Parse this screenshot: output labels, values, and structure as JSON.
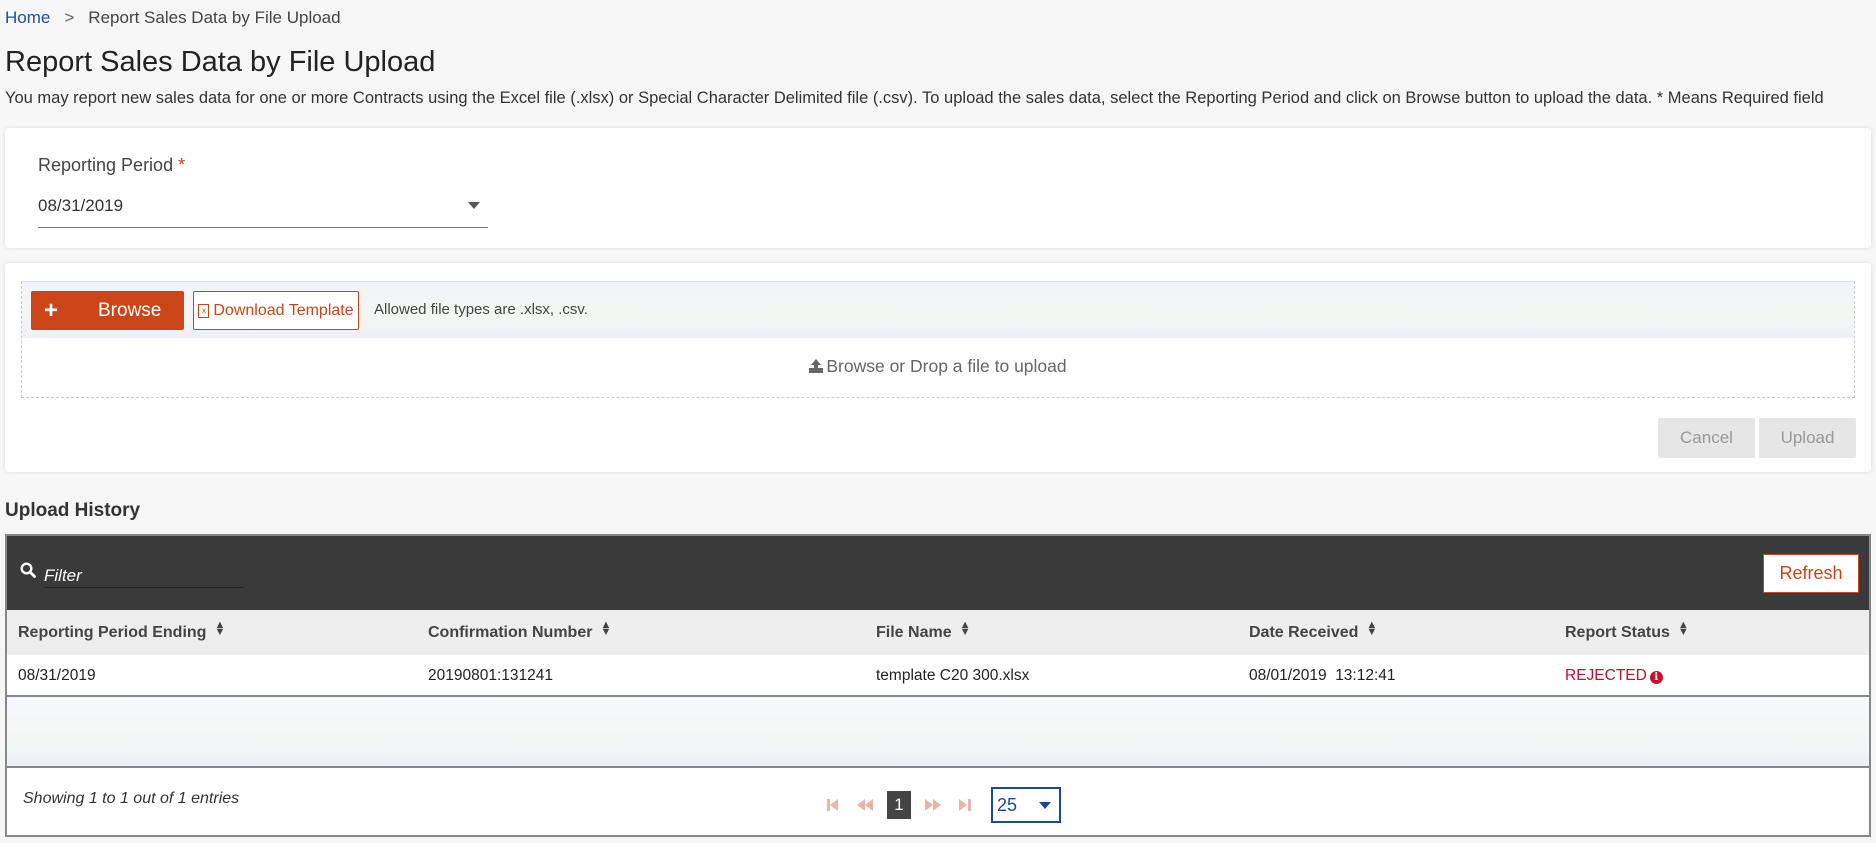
{
  "breadcrumb": {
    "home": "Home",
    "separator": ">",
    "current": "Report Sales Data by File Upload"
  },
  "page": {
    "title": "Report Sales Data by File Upload",
    "description": "You may report new sales data for one or more Contracts using the Excel file (.xlsx) or Special Character Delimited file (.csv). To upload the sales data, select the Reporting Period and click on Browse button to upload the data. * Means Required field"
  },
  "reporting_period": {
    "label": "Reporting Period",
    "required_mark": "*",
    "value": "08/31/2019"
  },
  "upload": {
    "browse_icon": "+",
    "browse_label": "Browse",
    "download_template_label": "Download Template",
    "template_icon_glyph": "x",
    "allowed_types": "Allowed file types are .xlsx, .csv.",
    "drop_text": "Browse or Drop a file to upload",
    "cancel_label": "Cancel",
    "upload_label": "Upload"
  },
  "history": {
    "title": "Upload History",
    "filter_placeholder": "Filter",
    "refresh_label": "Refresh",
    "sort_glyph": "▲▼",
    "columns": [
      "Reporting Period Ending",
      "Confirmation Number",
      "File Name",
      "Date Received",
      "Report Status"
    ],
    "rows": [
      {
        "period": "08/31/2019",
        "confirmation": "20190801:131241",
        "file": "template C20 300.xlsx",
        "received": "08/01/2019  13:12:41",
        "status": "REJECTED",
        "status_icon": "i"
      }
    ],
    "showing": "Showing 1 to 1 out of 1 entries",
    "pager": {
      "first": "⏮",
      "prev": "◀◀",
      "current_page": "1",
      "next": "▶▶",
      "last": "⏭",
      "page_size": "25"
    }
  },
  "colors": {
    "accent": "#cc4519",
    "rejected": "#c8102e",
    "toolbar": "#3a3a3a",
    "link": "#1f4f9a",
    "page_size": "#1a4a96"
  }
}
